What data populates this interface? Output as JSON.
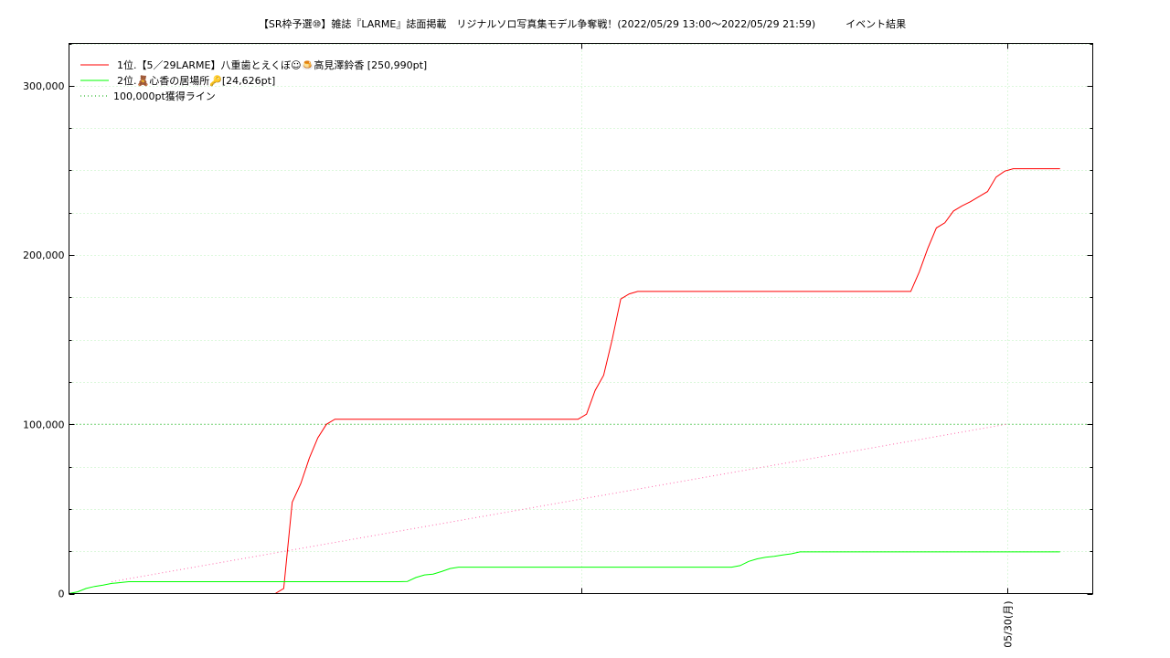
{
  "chart_data": {
    "type": "line",
    "title": "【SR枠予選⑩】雑誌『LARME』誌面掲載　リジナルソロ写真集モデル争奪戦！(2022/05/29 13:00～2022/05/29 21:59)　　　イベント結果",
    "xlabel": "",
    "ylabel": "",
    "ylim": [
      0,
      325000
    ],
    "xlim": [
      "2022/05/29 13:00",
      "2022/05/30 01:00"
    ],
    "x_ticks": [
      {
        "x": "2022/05/29 19:00",
        "label": ""
      },
      {
        "x": "2022/05/30 00:00",
        "label": "05/30(月)"
      }
    ],
    "y_ticks": [
      {
        "value": 0,
        "label": "0"
      },
      {
        "value": 100000,
        "label": "100,000"
      },
      {
        "value": 200000,
        "label": "200,000"
      },
      {
        "value": 300000,
        "label": "300,000"
      }
    ],
    "grid": true,
    "legend_position": "top-left",
    "series": [
      {
        "name": "1位.【5／29LARME】八重歯とえくぼ☺🍮高見澤鈴香 [250,990pt]",
        "color": "#ff0000",
        "style": "solid",
        "points": [
          [
            "2022/05/29 15:25",
            0
          ],
          [
            "2022/05/29 15:31",
            3000
          ],
          [
            "2022/05/29 15:37",
            54000
          ],
          [
            "2022/05/29 15:43",
            65000
          ],
          [
            "2022/05/29 15:49",
            80000
          ],
          [
            "2022/05/29 15:55",
            92000
          ],
          [
            "2022/05/29 16:01",
            100000
          ],
          [
            "2022/05/29 16:07",
            103000
          ],
          [
            "2022/05/29 16:13",
            103000
          ],
          [
            "2022/05/29 18:58",
            103000
          ],
          [
            "2022/05/29 19:04",
            106000
          ],
          [
            "2022/05/29 19:10",
            120000
          ],
          [
            "2022/05/29 19:16",
            129000
          ],
          [
            "2022/05/29 19:22",
            150000
          ],
          [
            "2022/05/29 19:28",
            174000
          ],
          [
            "2022/05/29 19:34",
            177000
          ],
          [
            "2022/05/29 19:40",
            178500
          ],
          [
            "2022/05/29 22:46",
            178500
          ],
          [
            "2022/05/29 22:52",
            178500
          ],
          [
            "2022/05/29 22:58",
            190000
          ],
          [
            "2022/05/29 23:04",
            204000
          ],
          [
            "2022/05/29 23:10",
            216000
          ],
          [
            "2022/05/29 23:16",
            219000
          ],
          [
            "2022/05/29 23:22",
            226000
          ],
          [
            "2022/05/29 23:28",
            229000
          ],
          [
            "2022/05/29 23:34",
            231500
          ],
          [
            "2022/05/29 23:40",
            234500
          ],
          [
            "2022/05/29 23:46",
            237500
          ],
          [
            "2022/05/29 23:52",
            246000
          ],
          [
            "2022/05/29 23:58",
            249500
          ],
          [
            "2022/05/30 00:04",
            250990
          ],
          [
            "2022/05/30 00:37",
            250990
          ]
        ]
      },
      {
        "name": "2位.🧸心香の居場所🔑[24,626pt]",
        "color": "#00ff00",
        "style": "solid",
        "points": [
          [
            "2022/05/29 13:00",
            0
          ],
          [
            "2022/05/29 13:06",
            1000
          ],
          [
            "2022/05/29 13:12",
            3000
          ],
          [
            "2022/05/29 13:18",
            4200
          ],
          [
            "2022/05/29 13:24",
            5000
          ],
          [
            "2022/05/29 13:30",
            6000
          ],
          [
            "2022/05/29 13:36",
            6500
          ],
          [
            "2022/05/29 13:42",
            7000
          ],
          [
            "2022/05/29 16:52",
            7000
          ],
          [
            "2022/05/29 16:58",
            7200
          ],
          [
            "2022/05/29 17:04",
            9500
          ],
          [
            "2022/05/29 17:10",
            11000
          ],
          [
            "2022/05/29 17:16",
            11500
          ],
          [
            "2022/05/29 17:22",
            13000
          ],
          [
            "2022/05/29 17:28",
            14800
          ],
          [
            "2022/05/29 17:34",
            15600
          ],
          [
            "2022/05/29 17:40",
            15600
          ],
          [
            "2022/05/29 20:46",
            15600
          ],
          [
            "2022/05/29 20:52",
            16500
          ],
          [
            "2022/05/29 20:58",
            19000
          ],
          [
            "2022/05/29 21:04",
            20500
          ],
          [
            "2022/05/29 21:10",
            21500
          ],
          [
            "2022/05/29 21:16",
            22000
          ],
          [
            "2022/05/29 21:22",
            22800
          ],
          [
            "2022/05/29 21:28",
            23500
          ],
          [
            "2022/05/29 21:34",
            24626
          ],
          [
            "2022/05/30 00:37",
            24626
          ]
        ]
      },
      {
        "name": "100,000pt獲得ライン",
        "color": "#00aa00",
        "style": "dotted",
        "points": [
          [
            "2022/05/29 13:00",
            100000
          ],
          [
            "2022/05/30 01:00",
            100000
          ]
        ]
      },
      {
        "name": "",
        "color": "#ff66aa",
        "style": "dotted",
        "points": [
          [
            "2022/05/29 13:30",
            7000
          ],
          [
            "2022/05/29 23:59",
            100000
          ]
        ]
      }
    ]
  }
}
